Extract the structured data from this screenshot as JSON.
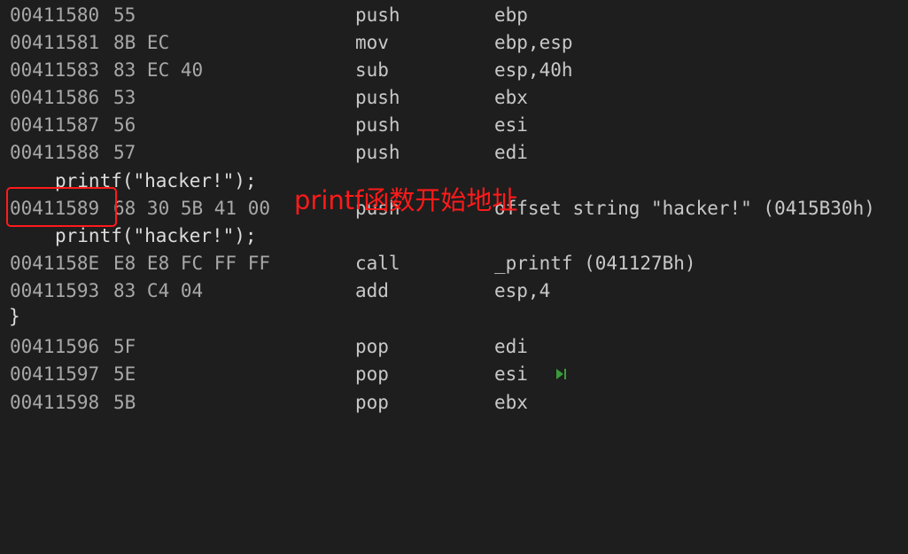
{
  "disassembly": {
    "lines": [
      {
        "kind": "asm",
        "addr": "00411580",
        "bytes": "55",
        "mnemonic": "push",
        "operands": "ebp"
      },
      {
        "kind": "asm",
        "addr": "00411581",
        "bytes": "8B EC",
        "mnemonic": "mov",
        "operands": "ebp,esp"
      },
      {
        "kind": "asm",
        "addr": "00411583",
        "bytes": "83 EC 40",
        "mnemonic": "sub",
        "operands": "esp,40h"
      },
      {
        "kind": "asm",
        "addr": "00411586",
        "bytes": "53",
        "mnemonic": "push",
        "operands": "ebx"
      },
      {
        "kind": "asm",
        "addr": "00411587",
        "bytes": "56",
        "mnemonic": "push",
        "operands": "esi"
      },
      {
        "kind": "asm",
        "addr": "00411588",
        "bytes": "57",
        "mnemonic": "push",
        "operands": "edi"
      },
      {
        "kind": "src",
        "text": "printf(\"hacker!\");"
      },
      {
        "kind": "asm",
        "addr": "00411589",
        "bytes": "68 30 5B 41 00",
        "mnemonic": "push",
        "operands": "offset string \"hacker!\" (0415B30h)"
      },
      {
        "kind": "src",
        "text": "printf(\"hacker!\");"
      },
      {
        "kind": "asm",
        "addr": "0041158E",
        "bytes": "E8 E8 FC FF FF",
        "mnemonic": "call",
        "operands": "_printf (041127Bh)"
      },
      {
        "kind": "asm",
        "addr": "00411593",
        "bytes": "83 C4 04",
        "mnemonic": "add",
        "operands": "esp,4"
      },
      {
        "kind": "brace",
        "text": "}"
      },
      {
        "kind": "asm",
        "addr": "00411596",
        "bytes": "5F",
        "mnemonic": "pop",
        "operands": "edi"
      },
      {
        "kind": "asm",
        "addr": "00411597",
        "bytes": "5E",
        "mnemonic": "pop",
        "operands": "esi"
      },
      {
        "kind": "asm",
        "addr": "00411598",
        "bytes": "5B",
        "mnemonic": "pop",
        "operands": "ebx"
      }
    ]
  },
  "annotation": {
    "label": "printf函数开始地址",
    "color": "#ff1a1a"
  },
  "icons": {
    "step_marker": "run-to-cursor-icon",
    "step_marker_color": "#3a9a3a"
  }
}
